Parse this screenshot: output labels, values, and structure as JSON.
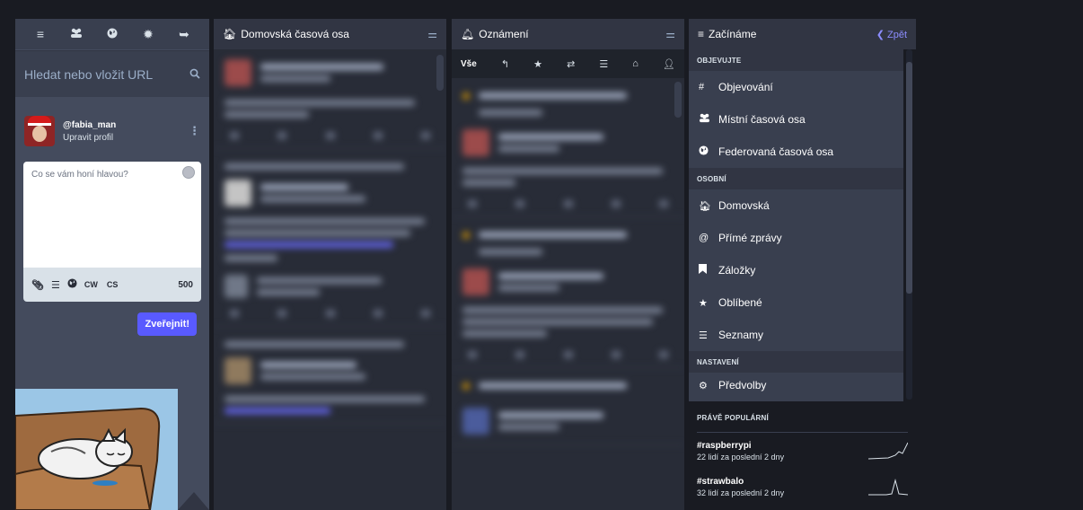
{
  "compose": {
    "search_placeholder": "Hledat nebo vložit URL",
    "account_handle": "@fabia_man",
    "edit_profile": "Upravit profil",
    "textarea_placeholder": "Co se vám honí hlavou?",
    "cw_label": "CW",
    "cs_label": "CS",
    "char_count": "500",
    "publish_label": "Zveřejnit!"
  },
  "home": {
    "title": "Domovská časová osa"
  },
  "notifications": {
    "title": "Oznámení",
    "filter_all": "Vše"
  },
  "getting_started": {
    "title": "Začínáme",
    "back_label": "Zpět",
    "sections": [
      {
        "label": "OBJEVUJTE"
      },
      {
        "label": "OSOBNÍ"
      },
      {
        "label": "NASTAVENÍ"
      }
    ],
    "items": [
      {
        "label": "Objevování",
        "icon": "hashtag-icon"
      },
      {
        "label": "Místní časová osa",
        "icon": "users-icon"
      },
      {
        "label": "Federovaná časová osa",
        "icon": "globe-icon"
      },
      {
        "label": "Domovská",
        "icon": "home-icon"
      },
      {
        "label": "Přímé zprávy",
        "icon": "at-icon"
      },
      {
        "label": "Záložky",
        "icon": "bookmark-icon"
      },
      {
        "label": "Oblíbené",
        "icon": "star-icon"
      },
      {
        "label": "Seznamy",
        "icon": "list-icon"
      },
      {
        "label": "Předvolby",
        "icon": "cogs-icon"
      }
    ]
  },
  "trends": {
    "title": "PRÁVĚ POPULÁRNÍ",
    "items": [
      {
        "tag": "#raspberrypi",
        "count": "22 lidí za poslední 2 dny"
      },
      {
        "tag": "#strawbalo",
        "count": "32 lidí za poslední 2 dny"
      }
    ]
  },
  "colors": {
    "background": "#191b22",
    "column": "#282c37",
    "header": "#313543",
    "accent": "#595aff",
    "link": "#8c8dff"
  }
}
